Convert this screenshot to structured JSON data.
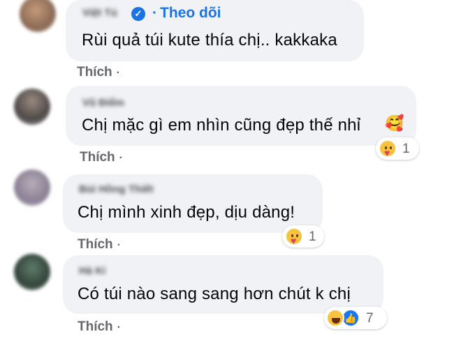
{
  "comments": [
    {
      "author_blurred": "Việt Tú",
      "verified": true,
      "follow_label": "Theo dõi",
      "text": "Rùi quả túi kute thía chị.. kakkaka",
      "like_label": "Thích",
      "separator": "·",
      "reactions": [],
      "reaction_count": ""
    },
    {
      "author_blurred": "Vũ Điểm",
      "text": "Chị mặc gì em nhìn cũng đẹp thế nhỉ",
      "trailing_emoji": "🥰",
      "like_label": "Thích",
      "separator": "·",
      "reactions": [
        "care"
      ],
      "reaction_count": "1"
    },
    {
      "author_blurred": "Bùi Hồng Thiết",
      "text": "Chị mình xinh đẹp, dịu dàng!",
      "like_label": "Thích",
      "separator": "·",
      "reactions": [
        "care"
      ],
      "reaction_count": "1"
    },
    {
      "author_blurred": "Hà Ki",
      "text": "Có túi nào sang sang hơn chút k chị",
      "like_label": "Thích",
      "separator": "·",
      "reactions": [
        "haha",
        "like"
      ],
      "reaction_count": "7"
    }
  ],
  "colors": {
    "bubble": "#f0f2f5",
    "link_blue": "#1b74e4",
    "secondary_text": "#65676b"
  },
  "icons": {
    "verified": "check-badge-icon",
    "care": "care-reaction-icon",
    "haha": "haha-reaction-icon",
    "like": "like-reaction-icon",
    "heart_face": "smiling-face-with-hearts-emoji"
  }
}
